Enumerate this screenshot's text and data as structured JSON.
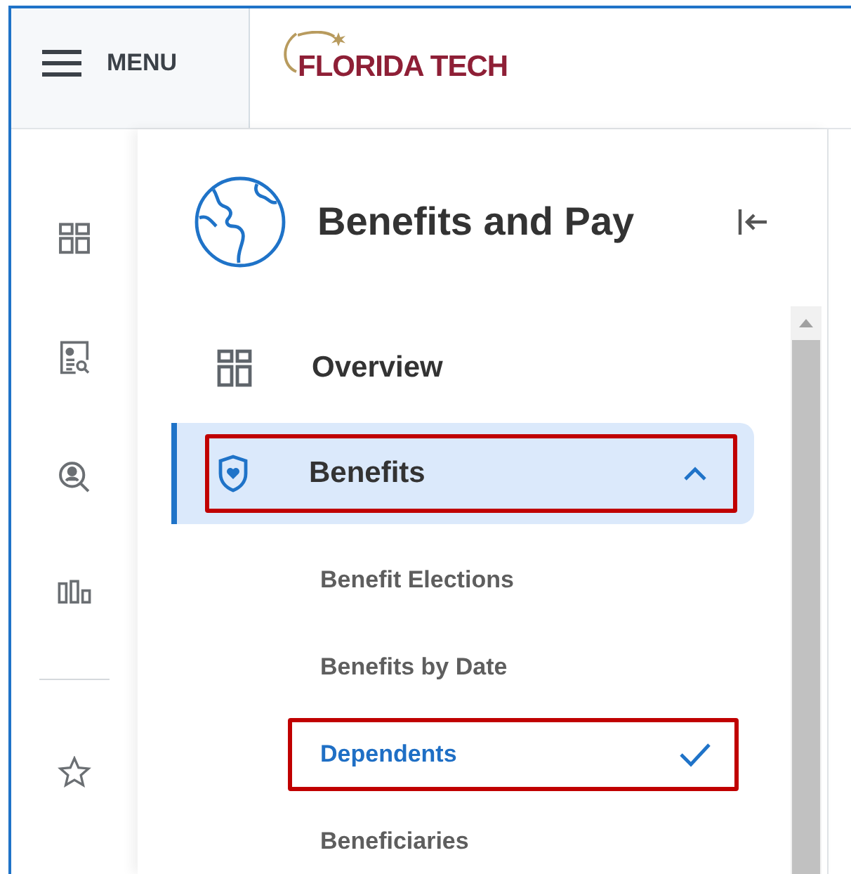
{
  "header": {
    "menu_label": "MENU",
    "logo_text": "FLORIDA TECH"
  },
  "panel": {
    "title": "Benefits and Pay"
  },
  "nav": [
    {
      "kind": "link",
      "label": "Overview",
      "selected": false
    },
    {
      "kind": "group",
      "label": "Benefits",
      "selected": true,
      "expanded": true,
      "annotated": true,
      "children": [
        {
          "label": "Benefit Elections",
          "selected": false,
          "annotated": false
        },
        {
          "label": "Benefits by Date",
          "selected": false,
          "annotated": false
        },
        {
          "label": "Dependents",
          "selected": true,
          "annotated": true
        },
        {
          "label": "Beneficiaries",
          "selected": false,
          "annotated": false
        }
      ]
    }
  ]
}
